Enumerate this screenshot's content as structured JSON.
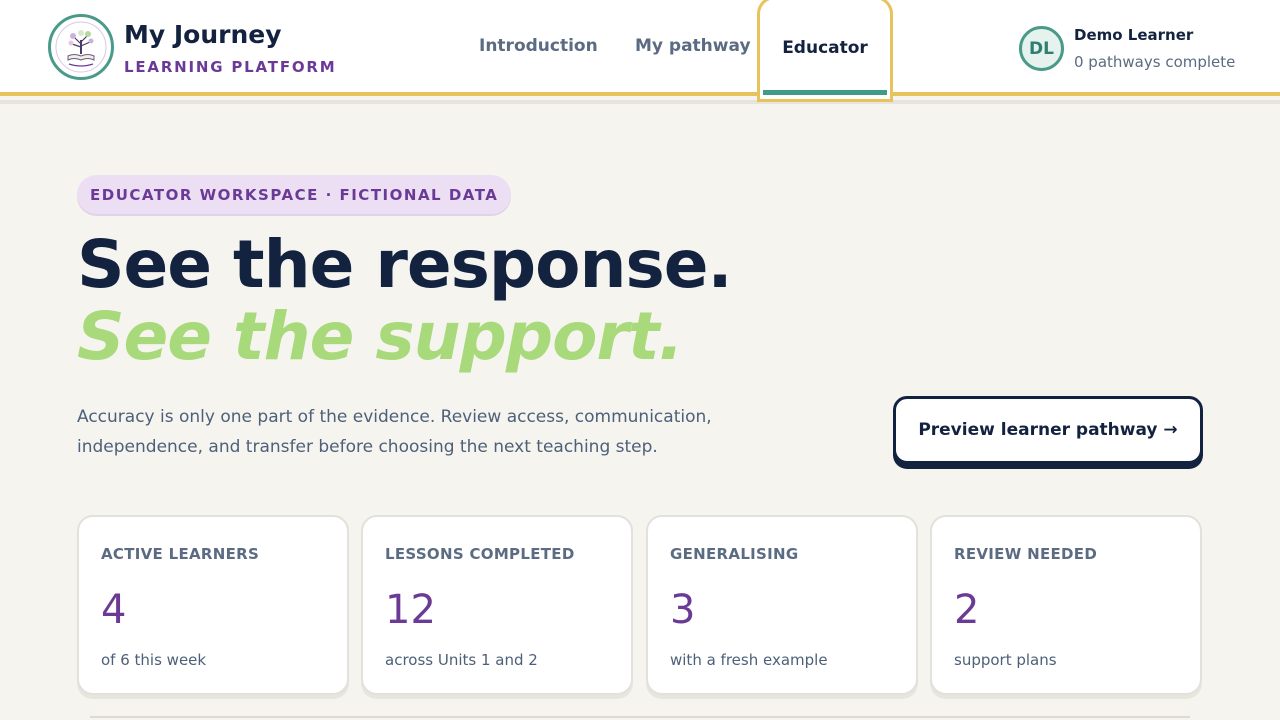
{
  "brand": {
    "title": "My Journey",
    "subtitle": "LEARNING PLATFORM",
    "logo_icon": "tree-book-logo-icon"
  },
  "nav": {
    "items": [
      {
        "label": "Introduction"
      },
      {
        "label": "My pathway"
      },
      {
        "label": "Educator"
      }
    ],
    "active": "Educator"
  },
  "user": {
    "initials": "DL",
    "name": "Demo Learner",
    "status": "0 pathways complete"
  },
  "hero": {
    "pill": "EDUCATOR WORKSPACE · FICTIONAL DATA",
    "title_line1": "See the response.",
    "title_line2": "See the support.",
    "lead": "Accuracy is only one part of the evidence. Review access, communication, independence, and transfer before choosing the next teaching step.",
    "cta_label": "Preview learner pathway →"
  },
  "stats": [
    {
      "label": "ACTIVE LEARNERS",
      "value": "4",
      "note": "of 6 this week"
    },
    {
      "label": "LESSONS COMPLETED",
      "value": "12",
      "note": "across Units 1 and 2"
    },
    {
      "label": "GENERALISING",
      "value": "3",
      "note": "with a fresh example"
    },
    {
      "label": "REVIEW NEEDED",
      "value": "2",
      "note": "support plans"
    }
  ],
  "colors": {
    "navy": "#13233f",
    "purple": "#6b3a96",
    "green_accent": "#a8d97a",
    "teal": "#3f9a89",
    "gold": "#e7c35d",
    "background": "#f5f4ef"
  }
}
